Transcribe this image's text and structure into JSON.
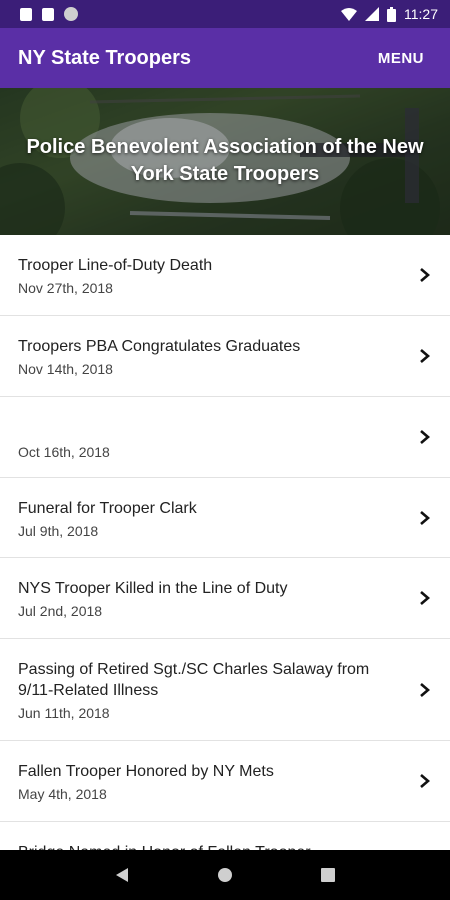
{
  "status_bar": {
    "time": "11:27"
  },
  "app_bar": {
    "title": "NY State Troopers",
    "menu_label": "MENU"
  },
  "hero": {
    "title": "Police Benevolent Association of the New York State Troopers"
  },
  "news": [
    {
      "title": "Trooper Line-of-Duty Death",
      "date": "Nov 27th, 2018"
    },
    {
      "title": "Troopers PBA Congratulates Graduates",
      "date": "Nov 14th, 2018"
    },
    {
      "title": "",
      "date": "Oct 16th, 2018"
    },
    {
      "title": "Funeral for Trooper Clark",
      "date": "Jul 9th, 2018"
    },
    {
      "title": "NYS Trooper Killed in the Line of Duty",
      "date": "Jul 2nd, 2018"
    },
    {
      "title": "Passing of Retired Sgt./SC Charles Salaway from 9/11-Related Illness",
      "date": "Jun 11th, 2018"
    },
    {
      "title": "Fallen Trooper Honored by NY Mets",
      "date": "May 4th, 2018"
    },
    {
      "title": "Bridge Named in Honor of Fallen Trooper",
      "date": ""
    }
  ],
  "colors": {
    "status_bar": "#3b1e78",
    "app_bar": "#5a2fa6",
    "nav_bar": "#000000"
  },
  "icons": {
    "chevron": "chevron-right-icon",
    "nav": [
      "back-icon",
      "home-icon",
      "recents-icon"
    ]
  }
}
